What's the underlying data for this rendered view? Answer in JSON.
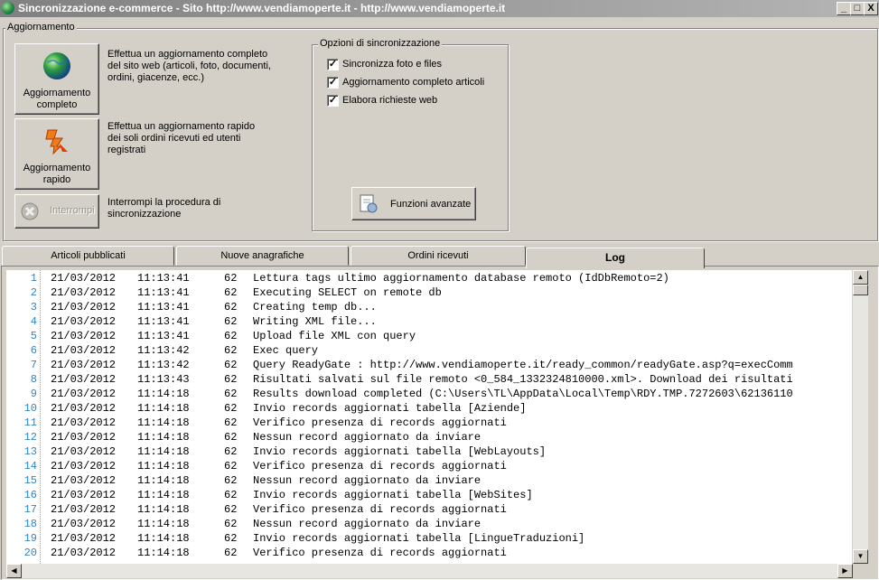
{
  "window": {
    "title": "Sincronizzazione e-commerce - Sito http://www.vendiamoperte.it - http://www.vendiamoperte.it",
    "min_label": "_",
    "max_label": "□",
    "close_label": "X"
  },
  "update_group": {
    "legend": "Aggiornamento",
    "full_update": {
      "label_line1": "Aggiornamento",
      "label_line2": "completo",
      "description": [
        "Effettua un aggiornamento completo",
        "del sito web (articoli, foto, documenti,",
        "ordini, giacenze, ecc.)"
      ]
    },
    "quick_update": {
      "label_line1": "Aggiornamento",
      "label_line2": "rapido",
      "description": [
        "Effettua un aggiornamento rapido",
        "dei soli ordini ricevuti ed utenti",
        "registrati"
      ]
    },
    "interrupt": {
      "label": "Interrompi",
      "description": [
        "Interrompi la procedura di",
        "sincronizzazione"
      ]
    }
  },
  "sync_options": {
    "legend": "Opzioni di sincronizzazione",
    "options": [
      {
        "label": "Sincronizza foto e files",
        "checked": true
      },
      {
        "label": "Aggiornamento completo articoli",
        "checked": true
      },
      {
        "label": "Elabora richieste web",
        "checked": true
      }
    ],
    "advanced_button": "Funzioni avanzate"
  },
  "tabs": [
    {
      "label": "Articoli pubblicati",
      "active": false
    },
    {
      "label": "Nuove anagrafiche",
      "active": false
    },
    {
      "label": "Ordini ricevuti",
      "active": false
    },
    {
      "label": "Log",
      "active": true
    }
  ],
  "log": {
    "rows": [
      {
        "n": "1",
        "date": "21/03/2012",
        "time": "11:13:41",
        "code": "62",
        "msg": "Lettura tags ultimo aggiornamento database remoto (IdDbRemoto=2)"
      },
      {
        "n": "2",
        "date": "21/03/2012",
        "time": "11:13:41",
        "code": "62",
        "msg": "Executing SELECT on remote db"
      },
      {
        "n": "3",
        "date": "21/03/2012",
        "time": "11:13:41",
        "code": "62",
        "msg": "Creating temp db..."
      },
      {
        "n": "4",
        "date": "21/03/2012",
        "time": "11:13:41",
        "code": "62",
        "msg": "Writing XML file..."
      },
      {
        "n": "5",
        "date": "21/03/2012",
        "time": "11:13:41",
        "code": "62",
        "msg": "Upload file XML con query"
      },
      {
        "n": "6",
        "date": "21/03/2012",
        "time": "11:13:42",
        "code": "62",
        "msg": "Exec query"
      },
      {
        "n": "7",
        "date": "21/03/2012",
        "time": "11:13:42",
        "code": "62",
        "msg": "Query ReadyGate : http://www.vendiamoperte.it/ready_common/readyGate.asp?q=execComm"
      },
      {
        "n": "8",
        "date": "21/03/2012",
        "time": "11:13:43",
        "code": "62",
        "msg": "Risultati salvati sul file remoto <0_584_1332324810000.xml>. Download dei risultati"
      },
      {
        "n": "9",
        "date": "21/03/2012",
        "time": "11:14:18",
        "code": "62",
        "msg": "Results download completed (C:\\Users\\TL\\AppData\\Local\\Temp\\RDY.TMP.7272603\\62136110"
      },
      {
        "n": "10",
        "date": "21/03/2012",
        "time": "11:14:18",
        "code": "62",
        "msg": "Invio records aggiornati tabella [Aziende]"
      },
      {
        "n": "11",
        "date": "21/03/2012",
        "time": "11:14:18",
        "code": "62",
        "msg": "Verifico presenza di records aggiornati"
      },
      {
        "n": "12",
        "date": "21/03/2012",
        "time": "11:14:18",
        "code": "62",
        "msg": "Nessun record aggiornato da inviare"
      },
      {
        "n": "13",
        "date": "21/03/2012",
        "time": "11:14:18",
        "code": "62",
        "msg": "Invio records aggiornati tabella [WebLayouts]"
      },
      {
        "n": "14",
        "date": "21/03/2012",
        "time": "11:14:18",
        "code": "62",
        "msg": "Verifico presenza di records aggiornati"
      },
      {
        "n": "15",
        "date": "21/03/2012",
        "time": "11:14:18",
        "code": "62",
        "msg": "Nessun record aggiornato da inviare"
      },
      {
        "n": "16",
        "date": "21/03/2012",
        "time": "11:14:18",
        "code": "62",
        "msg": "Invio records aggiornati tabella [WebSites]"
      },
      {
        "n": "17",
        "date": "21/03/2012",
        "time": "11:14:18",
        "code": "62",
        "msg": "Verifico presenza di records aggiornati"
      },
      {
        "n": "18",
        "date": "21/03/2012",
        "time": "11:14:18",
        "code": "62",
        "msg": "Nessun record aggiornato da inviare"
      },
      {
        "n": "19",
        "date": "21/03/2012",
        "time": "11:14:18",
        "code": "62",
        "msg": "Invio records aggiornati tabella [LingueTraduzioni]"
      },
      {
        "n": "20",
        "date": "21/03/2012",
        "time": "11:14:18",
        "code": "62",
        "msg": "Verifico presenza di records aggiornati"
      }
    ]
  }
}
